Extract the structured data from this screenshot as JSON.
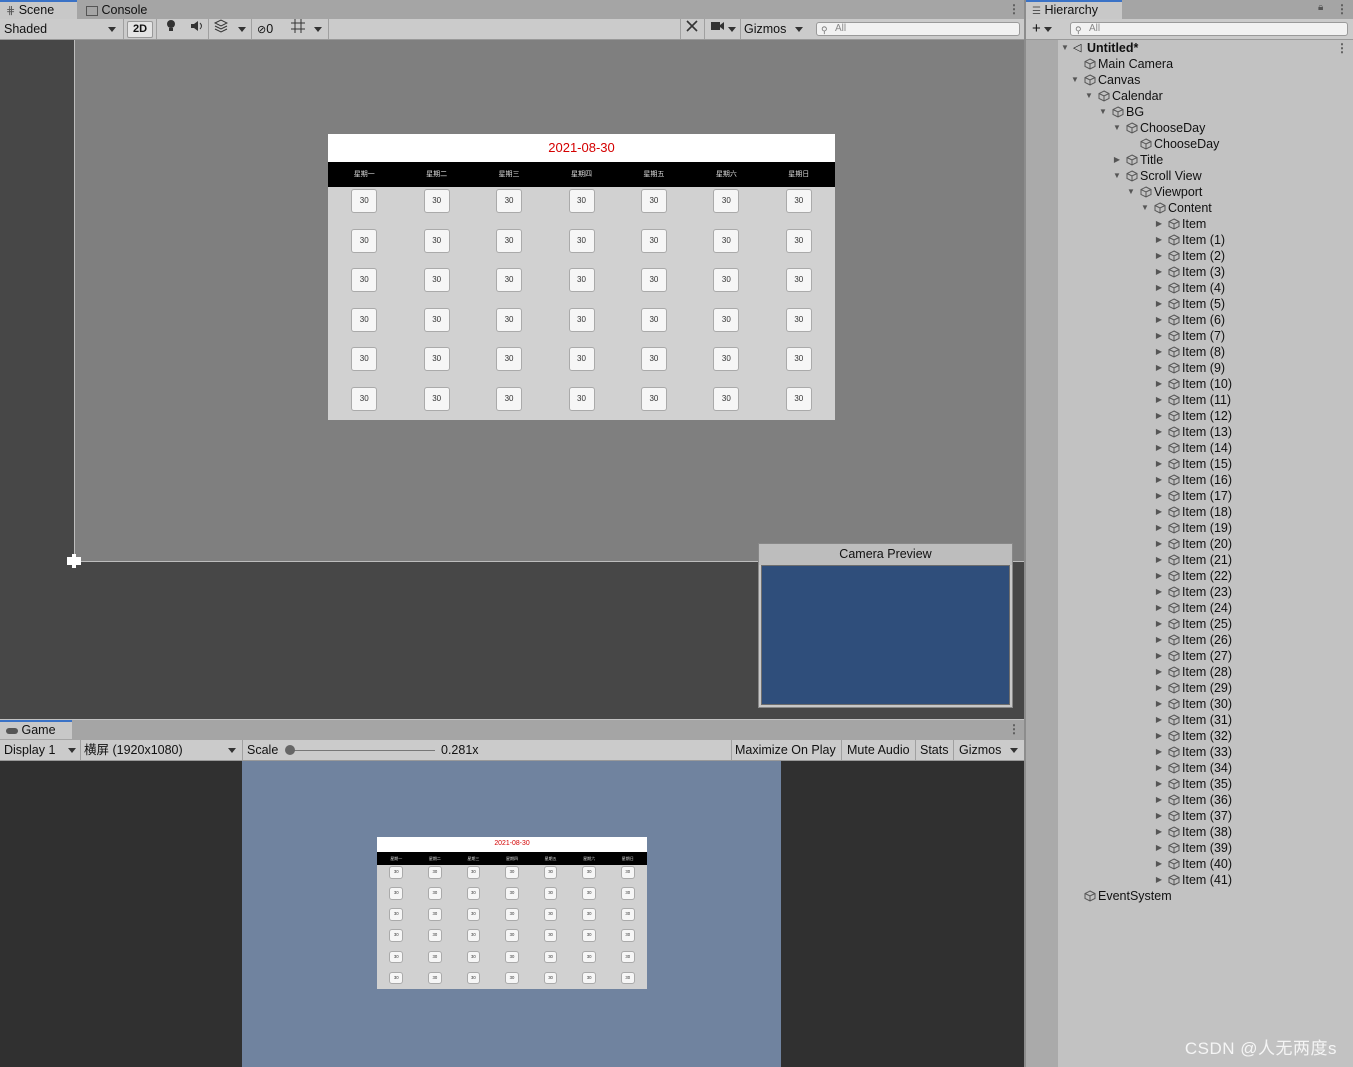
{
  "scene_tabs": {
    "scene": "Scene",
    "console": "Console"
  },
  "scene_toolbar": {
    "shading": "Shaded",
    "mode_2d": "2D",
    "hidden_count": "0",
    "gizmos": "Gizmos",
    "search_placeholder": "All",
    "icons": [
      "light-icon",
      "audio-icon",
      "effects-icon",
      "visibility-icon",
      "grid-icon",
      "tools-icon",
      "camera-icon"
    ]
  },
  "calendar": {
    "date": "2021-08-30",
    "weekdays": [
      "星期一",
      "星期二",
      "星期三",
      "星期四",
      "星期五",
      "星期六",
      "星期日"
    ],
    "day_value": "30"
  },
  "camera_preview": {
    "title": "Camera Preview"
  },
  "game_tab": {
    "label": "Game"
  },
  "game_toolbar": {
    "display": "Display 1",
    "resolution": "横屏 (1920x1080)",
    "scale_label": "Scale",
    "scale_value": "0.281x",
    "scale_fraction": 0.0,
    "maximize": "Maximize On Play",
    "mute": "Mute Audio",
    "stats": "Stats",
    "gizmos": "Gizmos"
  },
  "hierarchy": {
    "tab": "Hierarchy",
    "search_placeholder": "All",
    "scene_name": "Untitled*",
    "items": [
      {
        "label": "Main Camera",
        "depth": 1,
        "arrow": ""
      },
      {
        "label": "Canvas",
        "depth": 1,
        "arrow": "down"
      },
      {
        "label": "Calendar",
        "depth": 2,
        "arrow": "down"
      },
      {
        "label": "BG",
        "depth": 3,
        "arrow": "down"
      },
      {
        "label": "ChooseDay",
        "depth": 4,
        "arrow": "down"
      },
      {
        "label": "ChooseDay",
        "depth": 5,
        "arrow": ""
      },
      {
        "label": "Title",
        "depth": 4,
        "arrow": "right"
      },
      {
        "label": "Scroll View",
        "depth": 4,
        "arrow": "down"
      },
      {
        "label": "Viewport",
        "depth": 5,
        "arrow": "down"
      },
      {
        "label": "Content",
        "depth": 6,
        "arrow": "down"
      },
      {
        "label": "Item",
        "depth": 7,
        "arrow": "right"
      },
      {
        "label": "Item (1)",
        "depth": 7,
        "arrow": "right"
      },
      {
        "label": "Item (2)",
        "depth": 7,
        "arrow": "right"
      },
      {
        "label": "Item (3)",
        "depth": 7,
        "arrow": "right"
      },
      {
        "label": "Item (4)",
        "depth": 7,
        "arrow": "right"
      },
      {
        "label": "Item (5)",
        "depth": 7,
        "arrow": "right"
      },
      {
        "label": "Item (6)",
        "depth": 7,
        "arrow": "right"
      },
      {
        "label": "Item (7)",
        "depth": 7,
        "arrow": "right"
      },
      {
        "label": "Item (8)",
        "depth": 7,
        "arrow": "right"
      },
      {
        "label": "Item (9)",
        "depth": 7,
        "arrow": "right"
      },
      {
        "label": "Item (10)",
        "depth": 7,
        "arrow": "right"
      },
      {
        "label": "Item (11)",
        "depth": 7,
        "arrow": "right"
      },
      {
        "label": "Item (12)",
        "depth": 7,
        "arrow": "right"
      },
      {
        "label": "Item (13)",
        "depth": 7,
        "arrow": "right"
      },
      {
        "label": "Item (14)",
        "depth": 7,
        "arrow": "right"
      },
      {
        "label": "Item (15)",
        "depth": 7,
        "arrow": "right"
      },
      {
        "label": "Item (16)",
        "depth": 7,
        "arrow": "right"
      },
      {
        "label": "Item (17)",
        "depth": 7,
        "arrow": "right"
      },
      {
        "label": "Item (18)",
        "depth": 7,
        "arrow": "right"
      },
      {
        "label": "Item (19)",
        "depth": 7,
        "arrow": "right"
      },
      {
        "label": "Item (20)",
        "depth": 7,
        "arrow": "right"
      },
      {
        "label": "Item (21)",
        "depth": 7,
        "arrow": "right"
      },
      {
        "label": "Item (22)",
        "depth": 7,
        "arrow": "right"
      },
      {
        "label": "Item (23)",
        "depth": 7,
        "arrow": "right"
      },
      {
        "label": "Item (24)",
        "depth": 7,
        "arrow": "right"
      },
      {
        "label": "Item (25)",
        "depth": 7,
        "arrow": "right"
      },
      {
        "label": "Item (26)",
        "depth": 7,
        "arrow": "right"
      },
      {
        "label": "Item (27)",
        "depth": 7,
        "arrow": "right"
      },
      {
        "label": "Item (28)",
        "depth": 7,
        "arrow": "right"
      },
      {
        "label": "Item (29)",
        "depth": 7,
        "arrow": "right"
      },
      {
        "label": "Item (30)",
        "depth": 7,
        "arrow": "right"
      },
      {
        "label": "Item (31)",
        "depth": 7,
        "arrow": "right"
      },
      {
        "label": "Item (32)",
        "depth": 7,
        "arrow": "right"
      },
      {
        "label": "Item (33)",
        "depth": 7,
        "arrow": "right"
      },
      {
        "label": "Item (34)",
        "depth": 7,
        "arrow": "right"
      },
      {
        "label": "Item (35)",
        "depth": 7,
        "arrow": "right"
      },
      {
        "label": "Item (36)",
        "depth": 7,
        "arrow": "right"
      },
      {
        "label": "Item (37)",
        "depth": 7,
        "arrow": "right"
      },
      {
        "label": "Item (38)",
        "depth": 7,
        "arrow": "right"
      },
      {
        "label": "Item (39)",
        "depth": 7,
        "arrow": "right"
      },
      {
        "label": "Item (40)",
        "depth": 7,
        "arrow": "right"
      },
      {
        "label": "Item (41)",
        "depth": 7,
        "arrow": "right"
      },
      {
        "label": "EventSystem",
        "depth": 1,
        "arrow": ""
      }
    ]
  },
  "watermark": "CSDN @人无两度s",
  "colors": {
    "accent_tab": "#3a72c6",
    "calendar_date": "#d40000",
    "camera_bg": "#2f4e7b",
    "game_bg": "#70839f"
  }
}
